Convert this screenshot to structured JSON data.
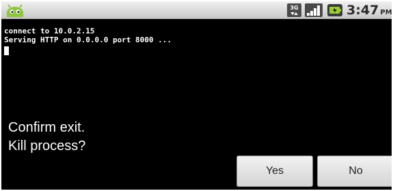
{
  "status_bar": {
    "notification_icon": "android-robot-icon",
    "network_type": "3G",
    "signal_icon": "signal-bars-icon",
    "battery_icon": "battery-charging-icon",
    "time": "3:47",
    "ampm": "PM"
  },
  "terminal": {
    "lines": [
      "connect to 10.0.2.15",
      "Serving HTTP on 0.0.0.0 port 8000 ..."
    ]
  },
  "dialog": {
    "line1": "Confirm exit.",
    "line2": "Kill process?",
    "yes_label": "Yes",
    "no_label": "No"
  },
  "colors": {
    "background": "#000000",
    "text": "#ffffff",
    "status_bar": "#e0e0e0",
    "button": "#e6e6e6"
  }
}
